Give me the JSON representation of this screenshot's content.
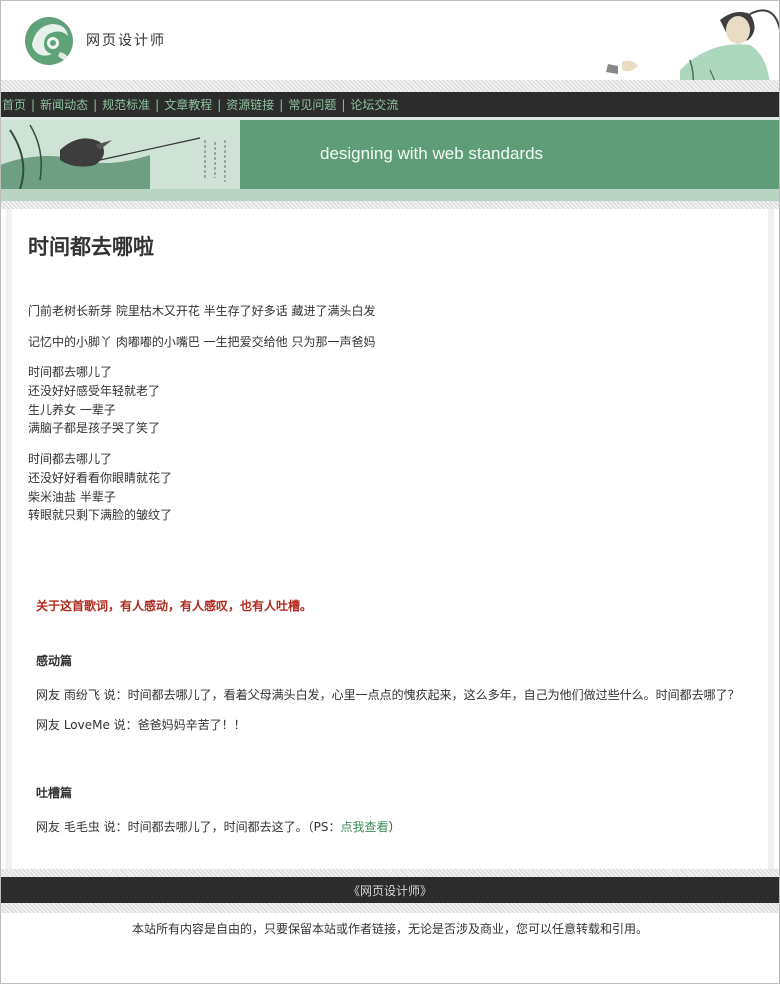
{
  "header": {
    "site_name": "网页设计师"
  },
  "nav": {
    "items": [
      {
        "label": "首页"
      },
      {
        "label": "新闻动态"
      },
      {
        "label": "规范标准"
      },
      {
        "label": "文章教程"
      },
      {
        "label": "资源链接"
      },
      {
        "label": "常见问题"
      },
      {
        "label": "论坛交流"
      }
    ],
    "separator": "|"
  },
  "banner": {
    "slogan": "designing with web standards"
  },
  "article": {
    "title": "时间都去哪啦",
    "lyrics": [
      "门前老树长新芽   院里枯木又开花   半生存了好多话   藏进了满头白发",
      "记忆中的小脚丫   肉嘟嘟的小嘴巴   一生把爱交给他   只为那一声爸妈",
      "时间都去哪儿了",
      "还没好好感受年轻就老了",
      "生儿养女  一辈子",
      "满脑子都是孩子哭了笑了",
      "时间都去哪儿了",
      "还没好好看看你眼睛就花了",
      "柴米油盐  半辈子",
      "转眼就只剩下满脸的皱纹了"
    ]
  },
  "comments": {
    "intro": "关于这首歌词，有人感动，有人感叹，也有人吐槽。",
    "touching_heading": "感动篇",
    "touching": [
      "网友 雨纷飞 说：时间都去哪儿了，看着父母满头白发，心里一点点的愧疚起来，这么多年，自己为他们做过些什么。时间都去哪了？",
      "网友 LoveMe 说：爸爸妈妈辛苦了！！"
    ],
    "complaint_heading": "吐槽篇",
    "complaint_text": "网友 毛毛虫 说：时间都去哪儿了，时间都去这了。（PS：",
    "complaint_link": "点我查看",
    "complaint_end": "）"
  },
  "footer": {
    "title": "《网页设计师》",
    "copyright": "本站所有内容是自由的，只要保留本站或作者链接，无论是否涉及商业，您可以任意转载和引用。"
  },
  "colors": {
    "nav_bg": "#2c2c2c",
    "nav_link": "#8fc4a2",
    "banner_green": "#5f9d78",
    "intro_red": "#b22a1e",
    "link_green": "#3a8a58"
  }
}
